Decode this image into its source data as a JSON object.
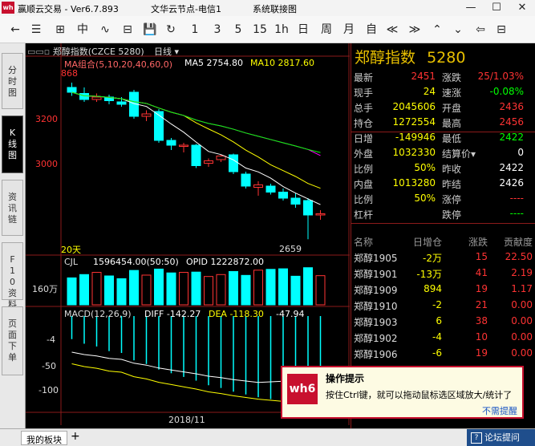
{
  "titlebar": {
    "logo": "wh",
    "app_title": "赢顺云交易  - Ver6.7.893",
    "node_title": "文华云节点-电信1",
    "sys_title": "系统联接图",
    "minimize": "—",
    "maximize": "☐",
    "close": "✕"
  },
  "toolbar": {
    "items": [
      "←",
      "☰",
      "⊞",
      "中",
      "∿",
      "⊟",
      "💾",
      "↻",
      "1",
      "3",
      "5",
      "15",
      "1h",
      "日",
      "周",
      "月",
      "自",
      "≪",
      "≫",
      "⌃",
      "⌄",
      "⇦",
      "⊟"
    ]
  },
  "left_tabs": [
    {
      "label": "分时图"
    },
    {
      "label": "K线图"
    },
    {
      "label": "资讯链"
    },
    {
      "label": "F10资料"
    },
    {
      "label": "页面下单"
    }
  ],
  "chart": {
    "header": "郑醇指数(CZCE 5280)",
    "period": "日线",
    "ma_label": "MA组合(5,10,20,40,60,0)",
    "ma5": "MA5 2754.80",
    "ma10": "MA10 2817.60",
    "top_price": "868",
    "price_labels": [
      "3200",
      "3000"
    ],
    "low_mark": "2659",
    "day_count": "20天",
    "cjl_label": "CJL",
    "cjl_value": "1596454.00(50:50)",
    "opid": "OPID 1222872.00",
    "vol_axis": "160万",
    "macd_label": "MACD(12,26,9)",
    "diff": "DIFF -142.27",
    "dea": "DEA -118.30",
    "macd_val": "-47.94",
    "macd_axis": [
      "-4",
      "-50",
      "-100"
    ],
    "date_label": "2018/11",
    "colors": {
      "up": "#ff3333",
      "down": "#00ffff",
      "ma5": "#ffffff",
      "ma10": "#ffff00",
      "ma20": "#ff00ff",
      "ma40": "#00ff00",
      "ma60": "#999999"
    }
  },
  "chart_data": {
    "type": "candlestick",
    "candles": [
      {
        "o": 3290,
        "c": 3270,
        "h": 3310,
        "l": 3255
      },
      {
        "o": 3265,
        "c": 3240,
        "h": 3290,
        "l": 3230
      },
      {
        "o": 3240,
        "c": 3250,
        "h": 3265,
        "l": 3230
      },
      {
        "o": 3250,
        "c": 3235,
        "h": 3260,
        "l": 3220
      },
      {
        "o": 3230,
        "c": 3220,
        "h": 3250,
        "l": 3210
      },
      {
        "o": 3270,
        "c": 3170,
        "h": 3280,
        "l": 3160
      },
      {
        "o": 3170,
        "c": 3180,
        "h": 3195,
        "l": 3150
      },
      {
        "o": 3190,
        "c": 3070,
        "h": 3200,
        "l": 3060
      },
      {
        "o": 3070,
        "c": 3050,
        "h": 3080,
        "l": 3030
      },
      {
        "o": 3045,
        "c": 3050,
        "h": 3060,
        "l": 3020
      },
      {
        "o": 3050,
        "c": 2965,
        "h": 3055,
        "l": 2955
      },
      {
        "o": 2975,
        "c": 2985,
        "h": 2995,
        "l": 2960
      },
      {
        "o": 2990,
        "c": 3005,
        "h": 3010,
        "l": 2980
      },
      {
        "o": 3010,
        "c": 2940,
        "h": 3015,
        "l": 2930
      },
      {
        "o": 2930,
        "c": 2880,
        "h": 2940,
        "l": 2870
      },
      {
        "o": 2875,
        "c": 2885,
        "h": 2900,
        "l": 2840
      },
      {
        "o": 2880,
        "c": 2855,
        "h": 2890,
        "l": 2845
      },
      {
        "o": 2855,
        "c": 2830,
        "h": 2870,
        "l": 2820
      },
      {
        "o": 2830,
        "c": 2805,
        "h": 2850,
        "l": 2790
      },
      {
        "o": 2820,
        "c": 2760,
        "h": 2830,
        "l": 2659
      },
      {
        "o": 2760,
        "c": 2765,
        "h": 2780,
        "l": 2740
      }
    ],
    "volume": [
      98,
      110,
      118,
      105,
      95,
      125,
      108,
      130,
      116,
      118,
      119,
      103,
      110,
      121,
      107,
      126,
      129,
      131,
      104,
      135,
      106
    ],
    "macd_hist": [
      -25,
      -30,
      -33,
      -38,
      -40,
      -48,
      -52,
      -58,
      -62,
      -66,
      -70,
      -75,
      -78,
      -82,
      -85,
      -88,
      -90,
      -92,
      -95,
      -98,
      -100
    ],
    "price_range": [
      2640,
      3340
    ]
  },
  "quote": {
    "name": "郑醇指数",
    "code": "5280",
    "rows": [
      {
        "l1": "最新",
        "v1": "2451",
        "c1": "#ff3333",
        "l2": "涨跌",
        "v2": "25/1.03%",
        "c2": "#ff3333"
      },
      {
        "l1": "现手",
        "v1": "24",
        "c1": "#ffff00",
        "l2": "速涨",
        "v2": "-0.08%",
        "c2": "#00ff00"
      },
      {
        "l1": "总手",
        "v1": "2045606",
        "c1": "#ffff00",
        "l2": "开盘",
        "v2": "2436",
        "c2": "#ff3333"
      },
      {
        "l1": "持仓",
        "v1": "1272554",
        "c1": "#ffff00",
        "l2": "最高",
        "v2": "2456",
        "c2": "#ff3333"
      },
      {
        "l1": "日增",
        "v1": "-149946",
        "c1": "#ffff00",
        "l2": "最低",
        "v2": "2422",
        "c2": "#00ff00"
      },
      {
        "l1": "外盘",
        "v1": "1032330",
        "c1": "#ffff00",
        "l2": "结算价▾",
        "v2": "0",
        "c2": "#ffffff"
      },
      {
        "l1": "比例",
        "v1": "50%",
        "c1": "#ffff00",
        "l2": "昨收",
        "v2": "2422",
        "c2": "#ffffff"
      },
      {
        "l1": "内盘",
        "v1": "1013280",
        "c1": "#ffff00",
        "l2": "昨结",
        "v2": "2426",
        "c2": "#ffffff"
      },
      {
        "l1": "比例",
        "v1": "50%",
        "c1": "#ffff00",
        "l2": "涨停",
        "v2": "----",
        "c2": "#ff3333"
      },
      {
        "l1": "杠杆",
        "v1": "",
        "c1": "#ffffff",
        "l2": "跌停",
        "v2": "----",
        "c2": "#00ff00"
      }
    ],
    "rel_headers": [
      "名称",
      "日增仓",
      "涨跌",
      "贡献度"
    ],
    "rel_rows": [
      {
        "n": "郑醇1905",
        "c": "-2万",
        "z": "15",
        "g": "22.50"
      },
      {
        "n": "郑醇1901",
        "c": "-13万",
        "z": "41",
        "g": "2.19"
      },
      {
        "n": "郑醇1909",
        "c": "894",
        "z": "19",
        "g": "1.17"
      },
      {
        "n": "郑醇1910",
        "c": "-2",
        "z": "21",
        "g": "0.00"
      },
      {
        "n": "郑醇1903",
        "c": "6",
        "z": "38",
        "g": "0.00"
      },
      {
        "n": "郑醇1902",
        "c": "-4",
        "z": "10",
        "g": "0.00"
      },
      {
        "n": "郑醇1906",
        "c": "-6",
        "z": "19",
        "g": "0.00"
      }
    ]
  },
  "bottom": {
    "tab_label": "我的板块",
    "add": "+",
    "forum": "论坛提问",
    "forum_icon": "?"
  },
  "popup": {
    "logo": "wh6",
    "title": "操作提示",
    "message": "按住Ctrl键，就可以拖动鼠标选区域放大/统计了",
    "dismiss": "不需提醒"
  }
}
